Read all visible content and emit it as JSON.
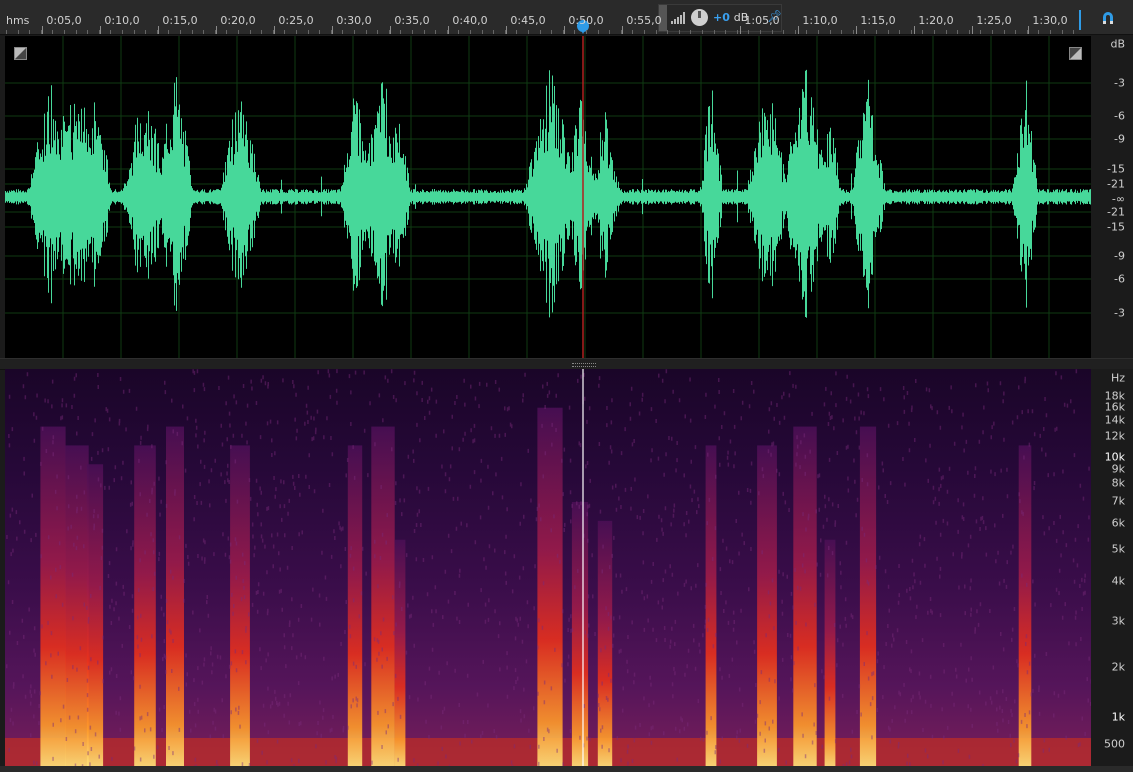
{
  "ruler": {
    "unit": "hms",
    "labels": [
      "0:05,0",
      "0:10,0",
      "0:15,0",
      "0:20,0",
      "0:25,0",
      "0:30,0",
      "0:35,0",
      "0:40,0",
      "0:45,0",
      "0:50,0",
      "0:55,0",
      "1:05,0",
      "1:10,0",
      "1:15,0",
      "1:20,0",
      "1:25,0",
      "1:30,0"
    ],
    "playhead_time": "0:50,0"
  },
  "hud": {
    "gain": "+0",
    "gain_unit": "dB",
    "icons": [
      "level-meter-icon",
      "volume-knob-icon",
      "pin-icon"
    ]
  },
  "waveform": {
    "color": "#47d89a",
    "scale_title": "dB",
    "db_labels_top": [
      "-3",
      "-6",
      "-9",
      "-15",
      "-21"
    ],
    "center_label": "-∞",
    "db_labels_bottom": [
      "-21",
      "-15",
      "-9",
      "-6",
      "-3"
    ]
  },
  "spectrogram": {
    "scale_title": "Hz",
    "hz_labels": [
      "18k",
      "16k",
      "14k",
      "12k",
      "10k",
      "9k",
      "8k",
      "7k",
      "6k",
      "5k",
      "4k",
      "3k",
      "2k",
      "1k",
      "500"
    ]
  },
  "colors": {
    "accent": "#2f9be6",
    "playhead": "#b02020",
    "wave": "#47d89a"
  }
}
